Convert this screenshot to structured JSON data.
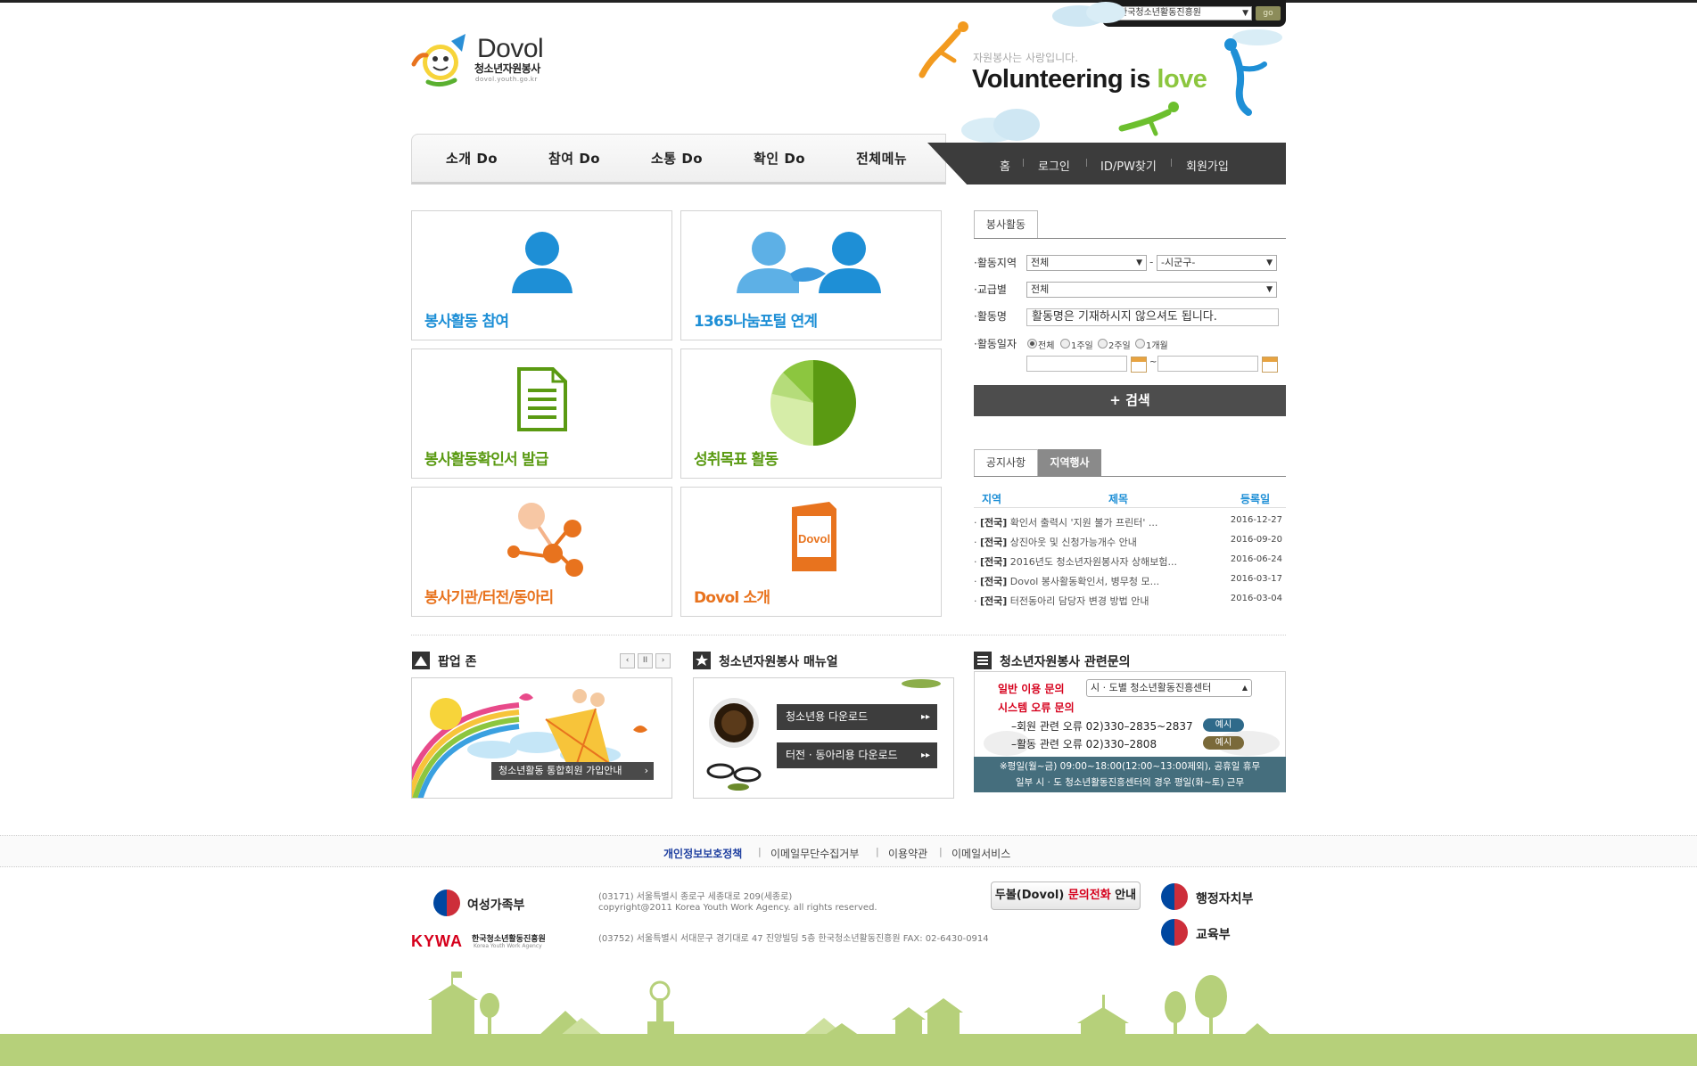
{
  "top_bar": {
    "site_select_value": "한국청소년활동진흥원",
    "go_label": "go"
  },
  "logo": {
    "title": "Dovol",
    "subtitle": "청소년자원봉사",
    "url": "dovol.youth.go.kr"
  },
  "slogan": {
    "small": "자원봉사는 사랑입니다.",
    "main_prefix": "Volunteering is ",
    "main_highlight": "love"
  },
  "nav": {
    "items": [
      "소개 Do",
      "참여 Do",
      "소통 Do",
      "확인 Do",
      "전체메뉴"
    ],
    "utility": [
      "홈",
      "로그인",
      "ID/PW찾기",
      "회원가입"
    ]
  },
  "tiles": [
    {
      "label": "봉사활동 참여",
      "color": "#1e8fd6"
    },
    {
      "label": "1365나눔포털 연계",
      "color": "#1e8fd6"
    },
    {
      "label": "봉사활동확인서 발급",
      "color": "#5a9a12"
    },
    {
      "label": "성취목표 활동",
      "color": "#5a9a12"
    },
    {
      "label": "봉사기관/터전/동아리",
      "color": "#e8731e"
    },
    {
      "label": "Dovol 소개",
      "color": "#e8731e"
    }
  ],
  "search": {
    "tab": "봉사활동",
    "region_label": "활동지역",
    "region_value": "전체",
    "region_sep": "-",
    "district_value": "-시군구-",
    "grade_label": "교급별",
    "grade_value": "전체",
    "name_label": "활동명",
    "name_value": "활동명은 기재하시지 않으셔도 됩니다.",
    "date_label": "활동일자",
    "date_options": [
      "전체",
      "1주일",
      "2주일",
      "1개월"
    ],
    "date_selected": "전체",
    "date_sep": "~",
    "button_label": "+ 검색"
  },
  "notice": {
    "tabs": [
      "공지사항",
      "지역행사"
    ],
    "active_tab": "지역행사",
    "headers": [
      "지역",
      "제목",
      "등록일"
    ],
    "rows": [
      {
        "region": "[전국]",
        "title": "확인서 출력시 '지원 불가 프린터' ...",
        "date": "2016-12-27"
      },
      {
        "region": "[전국]",
        "title": "상진아웃 및 신청가능개수 안내",
        "date": "2016-09-20"
      },
      {
        "region": "[전국]",
        "title": "2016년도 청소년자원봉사자 상해보험...",
        "date": "2016-06-24"
      },
      {
        "region": "[전국]",
        "title": "Dovol 봉사활동확인서, 병무청 모...",
        "date": "2016-03-17"
      },
      {
        "region": "[전국]",
        "title": "터전동아리 담당자 변경 방법 안내",
        "date": "2016-03-04"
      }
    ]
  },
  "popup_zone": {
    "title": "팝업 존",
    "controls": [
      "‹",
      "II",
      "›"
    ],
    "banner_text": "청소년활동 통합회원 가입안내"
  },
  "manual": {
    "title": "청소년자원봉사 매뉴얼",
    "buttons": [
      "청소년용 다운로드",
      "터전 · 동아리용 다운로드"
    ]
  },
  "inquiry": {
    "title": "청소년자원봉사 관련문의",
    "general_label": "일반 이용 문의",
    "general_select": "시 · 도별 청소년활동진흥센터",
    "system_label": "시스템 오류 문의",
    "member_text": "–회원 관련 오류  02)330–2835~2837",
    "activity_text": "–활동 관련 오류  02)330–2808",
    "example_label": "예시",
    "foot_line1": "※평일(월~금) 09:00~18:00(12:00~13:00제외), 공휴일 휴무",
    "foot_line2": "일부 시 · 도 청소년활동진흥센터의 경우 평일(화~토) 근무"
  },
  "footer": {
    "links": [
      "개인정보보호정책",
      "이메일무단수집거부",
      "이용약관",
      "이메일서비스"
    ],
    "active_link": "개인정보보호정책",
    "ministry_left": "여성가족부",
    "kywa_logo": "KYWA",
    "kywa_name": "한국청소년활동진흥원",
    "kywa_en": "Korea Youth Work Agency",
    "address1": "(03171) 서울특별시 종로구 세종대로 209(세종로)",
    "copyright": "copyright@2011 Korea Youth Work Agency. all rights reserved.",
    "address2": "(03752) 서울특별시 서대문구 경기대로 47 진양빌딩 5층 한국청소년활동진흥원   FAX: 02-6430-0914",
    "phone_btn_prefix": "두볼(Dovol) ",
    "phone_btn_highlight": "문의전화",
    "phone_btn_suffix": " 안내",
    "ministries_right": [
      "행정자치부",
      "교육부"
    ]
  },
  "colors": {
    "blue": "#1e8fd6",
    "green": "#5a9a12",
    "orange": "#e8731e",
    "love_green": "#8cc63f",
    "nav_dark": "#3c3c3c",
    "ground": "#b6d07a"
  }
}
